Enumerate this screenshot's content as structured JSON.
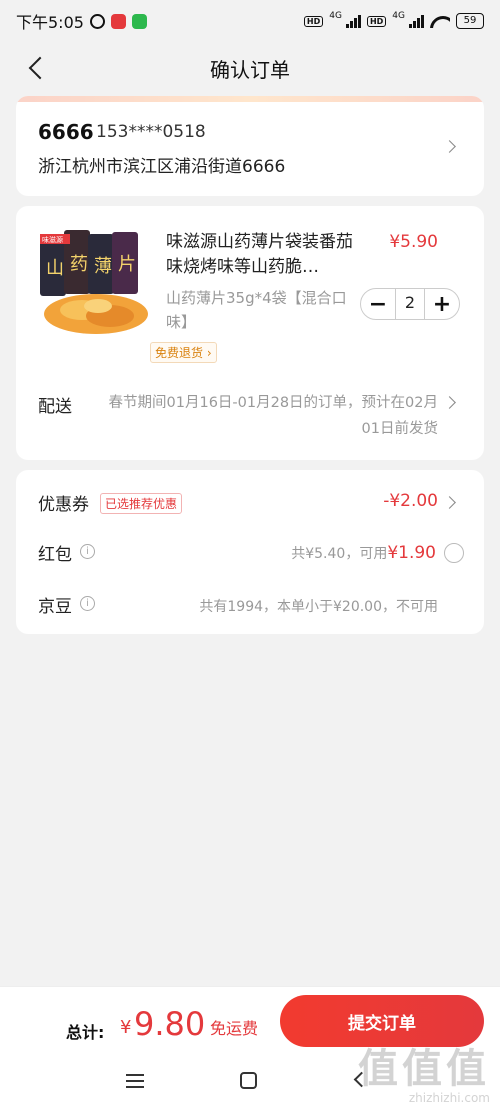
{
  "status_bar": {
    "time": "下午5:05",
    "hd1": "HD",
    "net1": "4G",
    "hd2": "HD",
    "net2": "4G",
    "battery": "59"
  },
  "header": {
    "title": "确认订单"
  },
  "address": {
    "name": "6666",
    "phone": "153****0518",
    "detail": "浙江杭州市滨江区浦沿街道6666"
  },
  "product": {
    "title": "味滋源山药薄片袋装番茄味烧烤味等山药脆…",
    "price": "¥5.90",
    "spec": "山药薄片35g*4袋【混合口味】",
    "quantity": "2",
    "minus": "−",
    "plus": "+",
    "free_return": "免费退货 ›",
    "image_brand": "味滋源"
  },
  "shipping": {
    "label": "配送",
    "text": "春节期间01月16日-01月28日的订单，预计在02月01日前发货"
  },
  "discounts": {
    "coupon_label": "优惠券",
    "coupon_tag": "已选推荐优惠",
    "coupon_value": "-¥2.00",
    "hongbao_label": "红包",
    "hongbao_total": "共¥5.40，可用",
    "hongbao_usable": "¥1.90",
    "jingdou_label": "京豆",
    "jingdou_text": "共有1994，本单小于¥20.00，不可用"
  },
  "footer": {
    "total_label": "总计:",
    "currency": "¥",
    "total": "9.80",
    "free_shipping": "免运费",
    "submit": "提交订单"
  },
  "watermark": {
    "big": "值值值",
    "small": "zhizhizhi.com"
  },
  "colors": {
    "accent": "#e4393c",
    "background": "#f2f2f2"
  }
}
